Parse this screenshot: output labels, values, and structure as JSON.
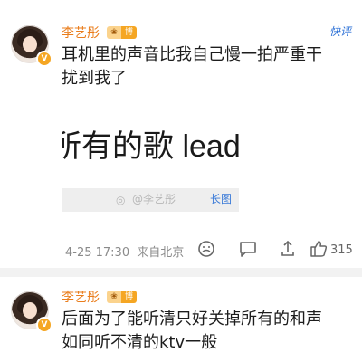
{
  "post1": {
    "username": "李艺彤",
    "tag": "博主",
    "fast_reply": "快评",
    "content_line1": "耳机里的声音比我自己慢一拍严重干",
    "content_line2": "扰到我了",
    "image": {
      "text": "所有的歌 lead 和",
      "watermark": "@李艺彤",
      "long_image_label": "长图"
    },
    "date": "4-25 17:30",
    "location": "来自北京",
    "like_count": "315"
  },
  "post2": {
    "username": "李艺彤",
    "tag": "博主",
    "content_line1": "后面为了能听清只好关掉所有的和声",
    "content_line2": "如同听不清的ktv一般"
  },
  "colors": {
    "username": "#ea7d1c",
    "badge": "#f5a623",
    "link_blue": "#2a6fd6",
    "divider": "#f2f2f2"
  },
  "icons": [
    "verified-badge-icon",
    "emoji-icon",
    "comment-icon",
    "like-icon",
    "image-watermark-icon"
  ]
}
